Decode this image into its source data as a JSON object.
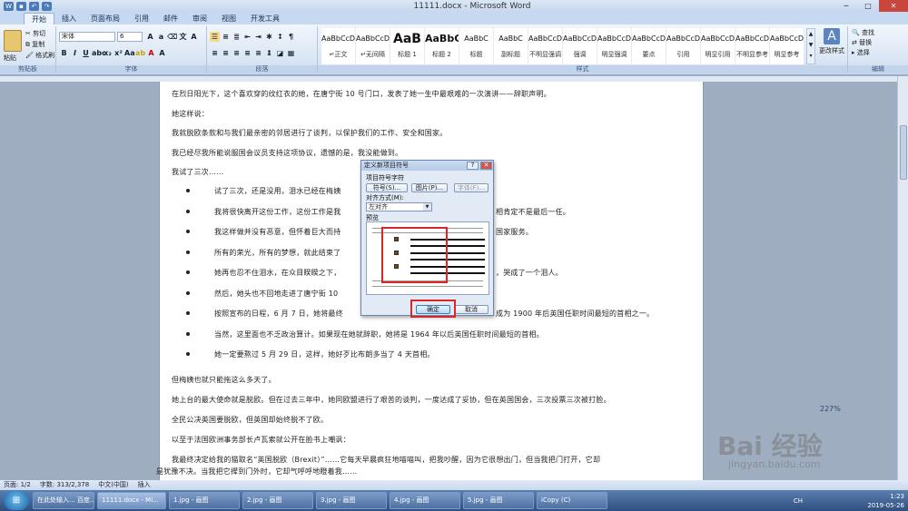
{
  "window": {
    "title": "11111.docx - Microsoft Word"
  },
  "tabs": [
    "开始",
    "插入",
    "页面布局",
    "引用",
    "邮件",
    "审阅",
    "视图",
    "开发工具"
  ],
  "clipboard": {
    "paste": "粘贴",
    "cut": "剪切",
    "copy": "复制",
    "format_painter": "格式刷",
    "group": "剪贴板"
  },
  "font": {
    "name": "宋体",
    "size": "6",
    "group": "字体"
  },
  "paragraph": {
    "group": "段落"
  },
  "styles": {
    "group": "样式",
    "items": [
      {
        "preview": "AaBbCcDd",
        "name": "↵正文"
      },
      {
        "preview": "AaBbCcDd",
        "name": "↵无间隔"
      },
      {
        "preview": "AaB",
        "name": "标题 1"
      },
      {
        "preview": "AaBbC",
        "name": "标题 2"
      },
      {
        "preview": "AaBbC",
        "name": "标题"
      },
      {
        "preview": "AaBbC",
        "name": "副标题"
      },
      {
        "preview": "AaBbCcDd",
        "name": "不明显强调"
      },
      {
        "preview": "AaBbCcDd",
        "name": "强调"
      },
      {
        "preview": "AaBbCcDd",
        "name": "明显强调"
      },
      {
        "preview": "AaBbCcDd",
        "name": "要点"
      },
      {
        "preview": "AaBbCcDd",
        "name": "引用"
      },
      {
        "preview": "AaBbCcDd",
        "name": "明显引用"
      },
      {
        "preview": "AaBbCcDd",
        "name": "不明显参考"
      },
      {
        "preview": "AaBbCcDd",
        "name": "明显参考"
      }
    ]
  },
  "change_styles": "更改样式",
  "editing": {
    "find": "查找",
    "replace": "替换",
    "select": "选择",
    "group": "编辑"
  },
  "document": {
    "paragraphs_top": [
      "在烈日阳光下，这个喜欢穿的纹红衣的她，在唐宁街 10 号门口，发表了她一生中最艰难的一次演讲——辞职声明。",
      "她这样说：",
      "我就脱欧条款和与我们最亲密的邻居进行了谈判，以保护我们的工作、安全和国家。",
      "我已经尽我所能说服国会议员支持这项协议，遗憾的是，我没能做到。",
      "我试了三次……"
    ],
    "bullets": [
      "试了三次，还是没用，泪水已经在梅姨",
      "我将很快离开这份工作，这份工作是我",
      "我这样做并没有恶意，但怀着巨大而持",
      "所有的荣光，所有的梦想，就此结束了",
      "她再也忍不住泪水，在众目睽睽之下，",
      "然后，她头也不回地走进了唐宁街 10",
      "按照宣布的日程，6 月 7 日，她将最终",
      "当然，这里面也不乏政治算计。如果现在她就辞职，她将是 1964 年以后英国任职时间最短的首相。",
      "她一定要熬过 5 月 29 日，这样，她好歹比布朗多当了 4 天首相。"
    ],
    "bullet_tails": [
      "",
      "相肯定不是最后一任。",
      "国家服务。",
      "",
      "，哭成了一个泪人。",
      "",
      "成为 1900 年后英国任职时间最短的首相之一。",
      "",
      ""
    ],
    "paragraphs_bottom": [
      "但梅姨也就只能拖这么多天了。",
      "她上台的最大使命就是脱欧。但在过去三年中，她同欧盟进行了艰苦的谈判，一度达成了妥协，但在英国国会，三次投票三次被打脸。",
      "全民公决英国要脱欧，但英国却始终脱不了欧。",
      "以至于法国欧洲事务部长卢瓦索就公开在脸书上嘲讽：",
      "我最终决定给我的猫取名“英国脱欧（Brexit）”……它每天早晨疯狂地喵喵叫，把我吵醒，因为它很想出门，但当我把门打开，它却",
      "是犹豫不决。当我把它撵到门外时，它却气呼呼地瞪着我……"
    ]
  },
  "dialog": {
    "title": "定义新项目符号",
    "char_group": "项目符号字符",
    "symbol_btn": "符号(S)...",
    "picture_btn": "图片(P)...",
    "font_btn": "字体(F)...",
    "align_label": "对齐方式(M):",
    "align_value": "左对齐",
    "preview_label": "预览",
    "ok": "确定",
    "cancel": "取消"
  },
  "status": {
    "page": "页面: 1/2",
    "words": "字数: 313/2,378",
    "lang": "中文(中国)",
    "mode": "插入"
  },
  "zoom": "227%",
  "taskbar": {
    "items": [
      "在此处输入... 百度...",
      "11111.docx - Mi...",
      "1.jpg - 画图",
      "2.jpg - 画图",
      "3.jpg - 画图",
      "4.jpg - 画图",
      "5.jpg - 画图",
      "iCopy (C)"
    ],
    "lang": "CH",
    "time": "1:23",
    "date": "2019-05-26"
  },
  "watermark": {
    "brand": "Bai 经验",
    "url": "jingyan.baidu.com"
  }
}
